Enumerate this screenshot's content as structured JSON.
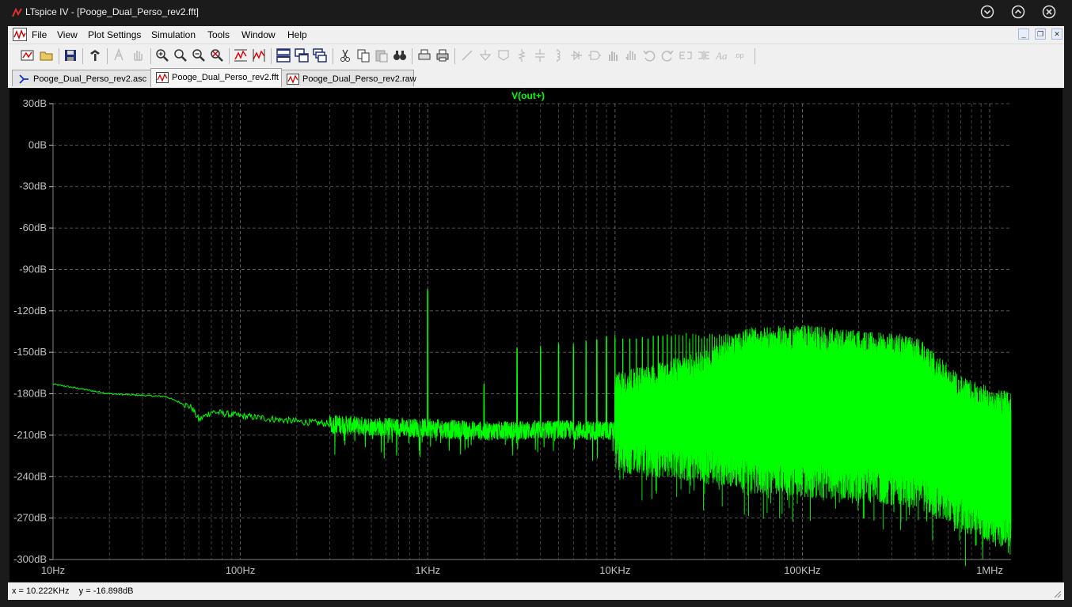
{
  "window": {
    "title": "LTspice IV - [Pooge_Dual_Perso_rev2.fft]",
    "controls": [
      "minimize-icon",
      "maximize-icon",
      "close-icon"
    ]
  },
  "menu": {
    "items": [
      "File",
      "View",
      "Plot Settings",
      "Simulation",
      "Tools",
      "Window",
      "Help"
    ],
    "mdi_controls": [
      "minimize-icon",
      "restore-icon",
      "close-icon"
    ]
  },
  "toolbar": {
    "buttons": [
      "new-schematic-icon",
      "open-icon",
      "save-icon",
      "control-panel-icon",
      "run-icon",
      "halt-icon",
      "zoom-in-icon",
      "zoom-out-icon",
      "zoom-fit-icon",
      "zoom-cancel-icon",
      "autorange-icon",
      "autorange-y-icon",
      "tile-horizontal-icon",
      "cascade-icon",
      "tile-vertical-icon",
      "cut-icon",
      "copy-icon",
      "paste-icon",
      "find-icon",
      "print-setup-icon",
      "print-icon",
      "wire-icon",
      "ground-icon",
      "label-icon",
      "resistor-icon",
      "capacitor-icon",
      "inductor-icon",
      "diode-icon",
      "component-icon",
      "move-icon",
      "drag-icon",
      "undo-icon",
      "redo-icon",
      "rotate-icon",
      "mirror-icon",
      "text-icon",
      "spice-directive-icon"
    ]
  },
  "tabs": [
    {
      "label": "Pooge_Dual_Perso_rev2.asc",
      "icon": "schematic-icon",
      "active": false
    },
    {
      "label": "Pooge_Dual_Perso_rev2.fft",
      "icon": "waveform-icon",
      "active": true
    },
    {
      "label": "Pooge_Dual_Perso_rev2.raw",
      "icon": "waveform-icon",
      "active": false
    }
  ],
  "plot": {
    "trace_name": "V(out+)",
    "trace_color": "#00ff00",
    "background": "#000000",
    "grid_color": "#808080",
    "label_color": "#c0c0c0"
  },
  "chart_data": {
    "type": "line",
    "title": "V(out+)",
    "xscale": "log",
    "xlim": [
      10,
      1300000
    ],
    "ylim": [
      -300,
      30
    ],
    "x_ticks": [
      "10Hz",
      "100Hz",
      "1KHz",
      "10KHz",
      "100KHz",
      "1MHz"
    ],
    "y_ticks": [
      "30dB",
      "0dB",
      "-30dB",
      "-60dB",
      "-90dB",
      "-120dB",
      "-150dB",
      "-180dB",
      "-210dB",
      "-240dB",
      "-270dB",
      "-300dB"
    ],
    "grid": true,
    "series": [
      {
        "name": "V(out+)",
        "baseline": {
          "x": [
            10,
            20,
            40,
            55,
            60,
            70,
            100,
            200,
            400,
            1000,
            2000,
            5000,
            10000,
            30000,
            100000,
            300000,
            600000,
            1300000
          ],
          "y": [
            -173,
            -180,
            -182,
            -190,
            -199,
            -193,
            -196,
            -200,
            -203,
            -205,
            -207,
            -206,
            -207,
            -209,
            -211,
            -213,
            -218,
            -220
          ]
        },
        "harmonics": {
          "x": [
            1000,
            2000,
            3000,
            4000,
            5000,
            6000,
            7000,
            8000,
            9000,
            10000,
            11000,
            12000,
            13000,
            14000,
            15000,
            16000,
            17000,
            18000,
            19000,
            20000,
            25000,
            30000
          ],
          "y": [
            -107,
            -174,
            -149,
            -147,
            -145,
            -146,
            -143,
            -142,
            -140,
            -140,
            -140,
            -140,
            -140,
            -139,
            -140,
            -138,
            -138,
            -138,
            -137,
            -139,
            -143,
            -145
          ]
        },
        "band_upper": {
          "x": [
            10000,
            30000,
            50000,
            100000,
            200000,
            400000,
            700000,
            1000000,
            1300000
          ],
          "y": [
            -183,
            -167,
            -150,
            -148,
            -152,
            -155,
            -185,
            -193,
            -197
          ]
        },
        "band_lower": {
          "x": [
            10000,
            30000,
            50000,
            100000,
            200000,
            400000,
            700000,
            1000000,
            1300000
          ],
          "y": [
            -212,
            -220,
            -227,
            -230,
            -233,
            -238,
            -255,
            -263,
            -268
          ]
        }
      }
    ]
  },
  "status": {
    "text": "x = 10.222KHz    y = -16.898dB"
  }
}
